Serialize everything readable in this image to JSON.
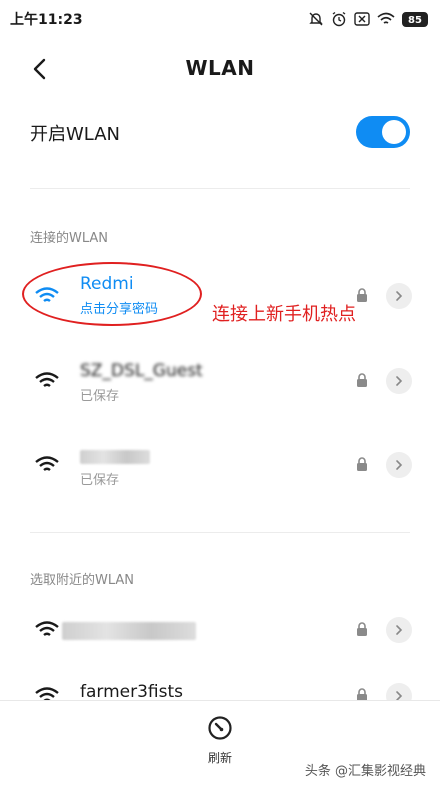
{
  "status": {
    "time": "上午11:23",
    "battery": "85"
  },
  "header": {
    "title": "WLAN"
  },
  "toggle": {
    "label": "开启WLAN",
    "on": true
  },
  "sections": {
    "connected": "连接的WLAN",
    "nearby": "选取附近的WLAN"
  },
  "connected_networks": [
    {
      "name": "Redmi",
      "sub": "点击分享密码"
    },
    {
      "name": "SZ_DSL_Guest",
      "sub": "已保存"
    },
    {
      "name": "",
      "sub": "已保存"
    }
  ],
  "nearby_networks": [
    {
      "name": ""
    },
    {
      "name": "farmer3fists"
    }
  ],
  "annotation": "连接上新手机热点",
  "bottom": {
    "refresh_label": "刷新"
  },
  "watermark": "头条 @汇集影视经典",
  "colors": {
    "accent": "#0f8cf3",
    "annotation": "#e02020"
  }
}
